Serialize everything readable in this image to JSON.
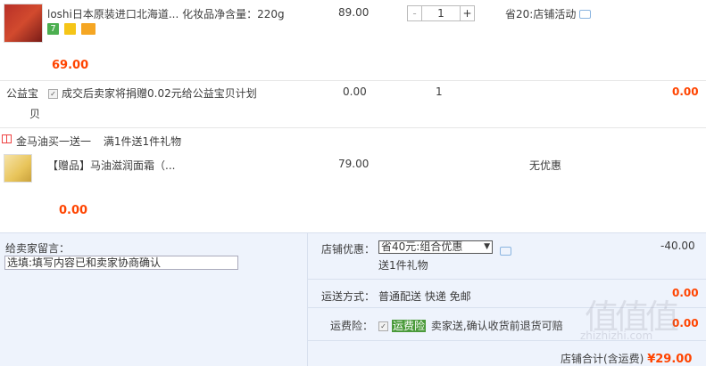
{
  "item1": {
    "title": "loshi日本原装进口北海道... 化妆品净含量：220g",
    "price": "89.00",
    "quantity": "1",
    "promo": "省20:店铺活动",
    "subtotal": "69.00",
    "badges": [
      "7",
      "bao",
      "card"
    ]
  },
  "charity": {
    "label1": "公益宝",
    "label2": "贝",
    "text": "成交后卖家将捐赠0.02元给公益宝贝计划",
    "price": "0.00",
    "quantity": "1",
    "total": "0.00"
  },
  "gift_promo": {
    "title": "金马油买一送一",
    "rule": "满1件送1件礼物"
  },
  "gift_item": {
    "title": "【赠品】马油滋润面霜（...",
    "price": "79.00",
    "discount": "无优惠",
    "subtotal": "0.00"
  },
  "message": {
    "label": "给卖家留言：",
    "placeholder": "选填:填写内容已和卖家协商确认"
  },
  "shop_discount": {
    "label": "店铺优惠：",
    "selected": "省40元:组合优惠",
    "extra": "送1件礼物",
    "amount": "-40.00"
  },
  "shipping": {
    "label": "运送方式：",
    "value": "普通配送 快递 免邮",
    "amount": "0.00"
  },
  "insurance": {
    "label": "运费险：",
    "tag": "运费险",
    "text": "卖家送,确认收货前退货可赔",
    "amount": "0.00"
  },
  "total": {
    "label": "店铺合计(含运费)",
    "amount": "¥29.00"
  },
  "watermark": {
    "text": "值值值",
    "small": "zhizhizhi.com"
  },
  "colors": {
    "accent": "#ff4400",
    "bottom_bg": "#eef3fc",
    "tag_green": "#4a9a3a"
  }
}
